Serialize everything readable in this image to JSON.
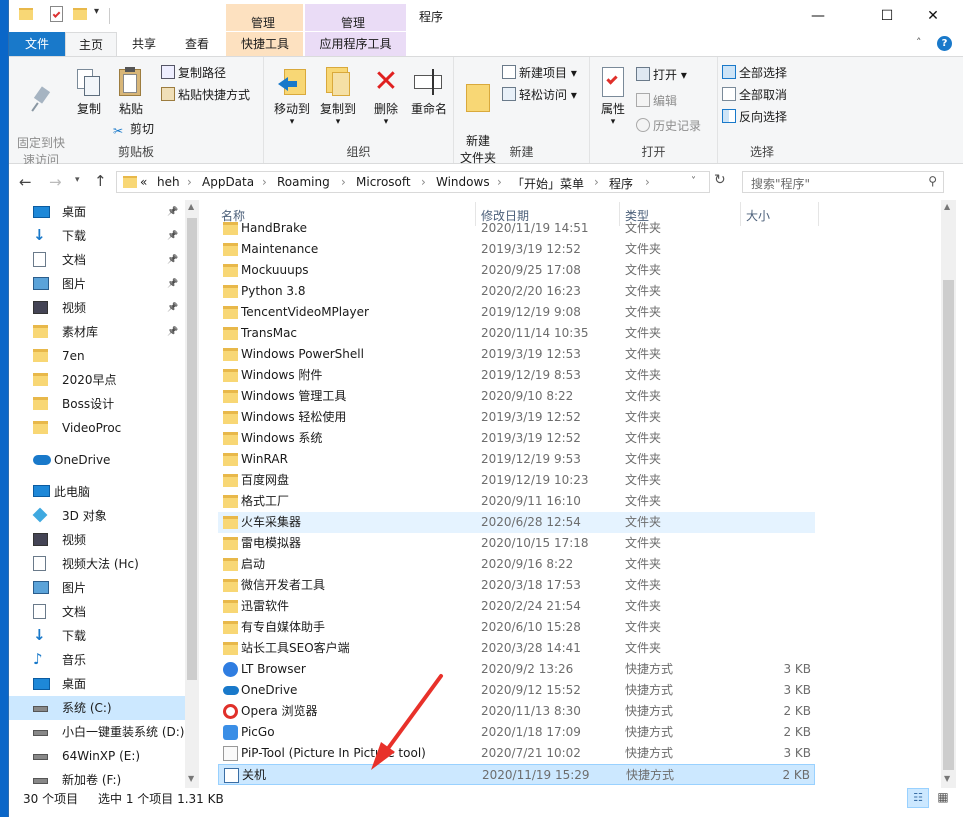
{
  "window": {
    "title": "程序",
    "context_tab_a": "管理",
    "context_tab_b": "管理",
    "minimize": "—",
    "maximize": "☐",
    "close": "✕"
  },
  "tabs": {
    "file": "文件",
    "home": "主页",
    "share": "共享",
    "view": "查看",
    "shortcut_tools": "快捷工具",
    "app_tools": "应用程序工具"
  },
  "ribbon": {
    "clipboard": {
      "label": "剪贴板",
      "pin_quick": "固定到快\n速访问",
      "copy": "复制",
      "paste": "粘贴",
      "copy_path": "复制路径",
      "paste_shortcut": "粘贴快捷方式",
      "cut": "剪切"
    },
    "organize": {
      "label": "组织",
      "move_to": "移动到",
      "copy_to": "复制到",
      "delete": "删除",
      "rename": "重命名"
    },
    "new": {
      "label": "新建",
      "new_folder": "新建\n文件夹",
      "new_item": "新建项目 ▾",
      "easy_access": "轻松访问 ▾"
    },
    "open": {
      "label": "打开",
      "properties": "属性",
      "open": "打开 ▾",
      "edit": "编辑",
      "history": "历史记录"
    },
    "select": {
      "label": "选择",
      "select_all": "全部选择",
      "select_none": "全部取消",
      "invert": "反向选择"
    }
  },
  "address": {
    "crumbs": [
      "«",
      "heh",
      "AppData",
      "Roaming",
      "Microsoft",
      "Windows",
      "「开始」菜单",
      "程序"
    ],
    "search_placeholder": "搜索\"程序\""
  },
  "nav": [
    {
      "label": "桌面",
      "icon": "desktop-icon",
      "pin": true
    },
    {
      "label": "下载",
      "icon": "download-icon",
      "pin": true
    },
    {
      "label": "文档",
      "icon": "document-icon",
      "pin": true
    },
    {
      "label": "图片",
      "icon": "picture-icon",
      "pin": true
    },
    {
      "label": "视频",
      "icon": "video-icon",
      "pin": true
    },
    {
      "label": "素材库",
      "icon": "folder-icon",
      "pin": true
    },
    {
      "label": "7en",
      "icon": "folder-icon",
      "pin": false
    },
    {
      "label": "2020早点",
      "icon": "folder-icon",
      "pin": false
    },
    {
      "label": "Boss设计",
      "icon": "folder-icon",
      "pin": false
    },
    {
      "label": "VideoProc",
      "icon": "folder-icon",
      "pin": false
    },
    {
      "label": "OneDrive",
      "icon": "onedrive-icon",
      "pin": false
    },
    {
      "label": "此电脑",
      "icon": "pc-icon",
      "pin": false
    },
    {
      "label": "3D 对象",
      "icon": "3d-icon",
      "pin": false
    },
    {
      "label": "视频",
      "icon": "video-icon",
      "pin": false
    },
    {
      "label": "视频大法 (Hc)",
      "icon": "document-icon",
      "pin": false
    },
    {
      "label": "图片",
      "icon": "picture-icon",
      "pin": false
    },
    {
      "label": "文档",
      "icon": "document-icon",
      "pin": false
    },
    {
      "label": "下载",
      "icon": "download-icon",
      "pin": false
    },
    {
      "label": "音乐",
      "icon": "music-icon",
      "pin": false
    },
    {
      "label": "桌面",
      "icon": "desktop-icon",
      "pin": false
    },
    {
      "label": "系统 (C:)",
      "icon": "drive-icon",
      "pin": false
    },
    {
      "label": "小白一键重装系统 (D:)",
      "icon": "drive-icon",
      "pin": false
    },
    {
      "label": "64WinXP  (E:)",
      "icon": "drive-icon",
      "pin": false
    },
    {
      "label": "新加卷 (F:)",
      "icon": "drive-icon",
      "pin": false
    }
  ],
  "columns": {
    "name": "名称",
    "date": "修改日期",
    "type": "类型",
    "size": "大小"
  },
  "files": [
    {
      "name": "HandBrake",
      "date": "2020/11/19 14:51",
      "type": "文件夹",
      "size": "",
      "icon": "folder"
    },
    {
      "name": "Maintenance",
      "date": "2019/3/19 12:52",
      "type": "文件夹",
      "size": "",
      "icon": "folder"
    },
    {
      "name": "Mockuuups",
      "date": "2020/9/25 17:08",
      "type": "文件夹",
      "size": "",
      "icon": "folder"
    },
    {
      "name": "Python 3.8",
      "date": "2020/2/20 16:23",
      "type": "文件夹",
      "size": "",
      "icon": "folder"
    },
    {
      "name": "TencentVideoMPlayer",
      "date": "2019/12/19 9:08",
      "type": "文件夹",
      "size": "",
      "icon": "folder"
    },
    {
      "name": "TransMac",
      "date": "2020/11/14 10:35",
      "type": "文件夹",
      "size": "",
      "icon": "folder"
    },
    {
      "name": "Windows PowerShell",
      "date": "2019/3/19 12:53",
      "type": "文件夹",
      "size": "",
      "icon": "folder"
    },
    {
      "name": "Windows 附件",
      "date": "2019/12/19 8:53",
      "type": "文件夹",
      "size": "",
      "icon": "folder"
    },
    {
      "name": "Windows 管理工具",
      "date": "2020/9/10 8:22",
      "type": "文件夹",
      "size": "",
      "icon": "folder"
    },
    {
      "name": "Windows 轻松使用",
      "date": "2019/3/19 12:52",
      "type": "文件夹",
      "size": "",
      "icon": "folder"
    },
    {
      "name": "Windows 系统",
      "date": "2019/3/19 12:52",
      "type": "文件夹",
      "size": "",
      "icon": "folder"
    },
    {
      "name": "WinRAR",
      "date": "2019/12/19 9:53",
      "type": "文件夹",
      "size": "",
      "icon": "folder"
    },
    {
      "name": "百度网盘",
      "date": "2019/12/19 10:23",
      "type": "文件夹",
      "size": "",
      "icon": "folder"
    },
    {
      "name": "格式工厂",
      "date": "2020/9/11 16:10",
      "type": "文件夹",
      "size": "",
      "icon": "folder"
    },
    {
      "name": "火车采集器",
      "date": "2020/6/28 12:54",
      "type": "文件夹",
      "size": "",
      "icon": "folder",
      "state": "hov"
    },
    {
      "name": "雷电模拟器",
      "date": "2020/10/15 17:18",
      "type": "文件夹",
      "size": "",
      "icon": "folder"
    },
    {
      "name": "启动",
      "date": "2020/9/16 8:22",
      "type": "文件夹",
      "size": "",
      "icon": "folder"
    },
    {
      "name": "微信开发者工具",
      "date": "2020/3/18 17:53",
      "type": "文件夹",
      "size": "",
      "icon": "folder"
    },
    {
      "name": "迅雷软件",
      "date": "2020/2/24 21:54",
      "type": "文件夹",
      "size": "",
      "icon": "folder"
    },
    {
      "name": "有专自媒体助手",
      "date": "2020/6/10 15:28",
      "type": "文件夹",
      "size": "",
      "icon": "folder"
    },
    {
      "name": "站长工具SEO客户端",
      "date": "2020/3/28 14:41",
      "type": "文件夹",
      "size": "",
      "icon": "folder"
    },
    {
      "name": "LT Browser",
      "date": "2020/9/2 13:26",
      "type": "快捷方式",
      "size": "3 KB",
      "icon": "ltbrowser"
    },
    {
      "name": "OneDrive",
      "date": "2020/9/12 15:52",
      "type": "快捷方式",
      "size": "3 KB",
      "icon": "onedrive"
    },
    {
      "name": "Opera 浏览器",
      "date": "2020/11/13 8:30",
      "type": "快捷方式",
      "size": "2 KB",
      "icon": "opera"
    },
    {
      "name": "PicGo",
      "date": "2020/1/18 17:09",
      "type": "快捷方式",
      "size": "2 KB",
      "icon": "picgo"
    },
    {
      "name": "PiP-Tool  (Picture In Picture tool)",
      "date": "2020/7/21 10:02",
      "type": "快捷方式",
      "size": "3 KB",
      "icon": "pip"
    },
    {
      "name": "关机",
      "date": "2020/11/19 15:29",
      "type": "快捷方式",
      "size": "2 KB",
      "icon": "shortcut",
      "state": "sel"
    }
  ],
  "status": {
    "count": "30 个项目",
    "selected": "选中 1 个项目  1.31 KB"
  },
  "colors": {
    "accent": "#1979ca",
    "selection": "#cce8ff",
    "hover": "#e5f3ff",
    "folder": "#f8d775",
    "annotation_arrow": "#e8312a"
  }
}
